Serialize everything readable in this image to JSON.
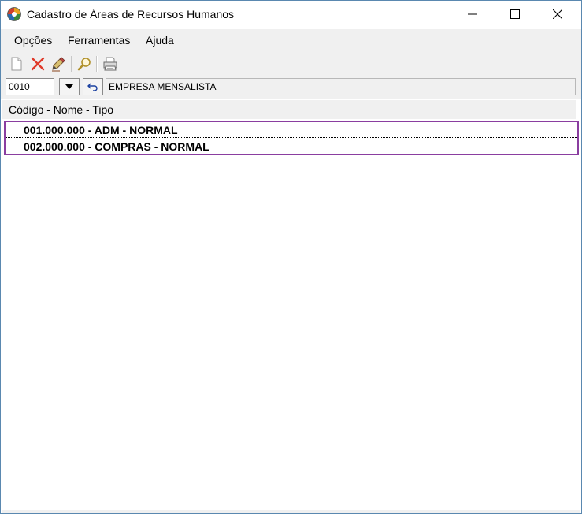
{
  "window": {
    "title": "Cadastro de Áreas de Recursos Humanos",
    "icon": "globe-app-icon"
  },
  "menu": {
    "items": [
      {
        "label": "Opções"
      },
      {
        "label": "Ferramentas"
      },
      {
        "label": "Ajuda"
      }
    ]
  },
  "toolbar": {
    "buttons": [
      {
        "icon": "new-document-icon"
      },
      {
        "icon": "delete-x-icon"
      },
      {
        "icon": "edit-pencil-icon"
      },
      {
        "icon": "search-magnifier-icon"
      },
      {
        "icon": "printer-icon"
      }
    ]
  },
  "filter": {
    "code_value": "0010",
    "company_name": "EMPRESA MENSALISTA"
  },
  "list": {
    "column_header": "Código - Nome - Tipo",
    "rows": [
      {
        "text": "001.000.000 - ADM - NORMAL"
      },
      {
        "text": "002.000.000 - COMPRAS - NORMAL"
      }
    ]
  },
  "colors": {
    "selection_frame": "#8a3ea0",
    "window_border": "#5a88b0",
    "delete_icon": "#e03a2a"
  }
}
